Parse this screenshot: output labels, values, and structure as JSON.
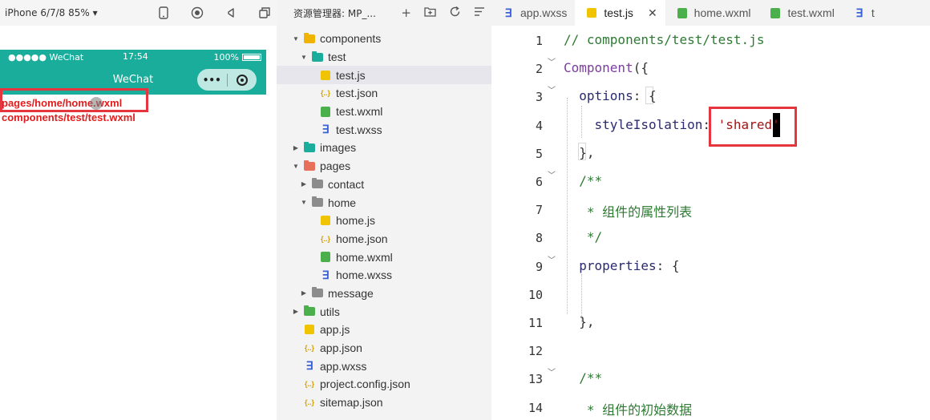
{
  "simulator": {
    "device": "iPhone 6/7/8 85% ▾",
    "status": {
      "signal": "●●●●● WeChat",
      "time": "17:54",
      "battery": "100%"
    },
    "nav_title": "WeChat",
    "capsule_dots": "•••",
    "lines": [
      "pages/home/home.wxml",
      "components/test/test.wxml"
    ],
    "accent": "#1aad9b",
    "highlight": "#e5353f"
  },
  "explorer": {
    "title": "资源管理器: MP_...",
    "tree": [
      {
        "label": "components",
        "type": "folder",
        "color": "#f0b400",
        "depth": 0,
        "open": true
      },
      {
        "label": "test",
        "type": "folder",
        "color": "#1aad9b",
        "depth": 1,
        "open": true
      },
      {
        "label": "test.js",
        "type": "js",
        "depth": 2,
        "selected": true
      },
      {
        "label": "test.json",
        "type": "json",
        "depth": 2
      },
      {
        "label": "test.wxml",
        "type": "wxml",
        "depth": 2
      },
      {
        "label": "test.wxss",
        "type": "wxss",
        "depth": 2
      },
      {
        "label": "images",
        "type": "folder",
        "color": "#1aad9b",
        "depth": 0,
        "open": false
      },
      {
        "label": "pages",
        "type": "folder",
        "color": "#e8705a",
        "depth": 0,
        "open": true
      },
      {
        "label": "contact",
        "type": "folder",
        "color": "#8c8c8c",
        "depth": 1,
        "open": false
      },
      {
        "label": "home",
        "type": "folder",
        "color": "#8c8c8c",
        "depth": 1,
        "open": true
      },
      {
        "label": "home.js",
        "type": "js",
        "depth": 2
      },
      {
        "label": "home.json",
        "type": "json",
        "depth": 2
      },
      {
        "label": "home.wxml",
        "type": "wxml",
        "depth": 2
      },
      {
        "label": "home.wxss",
        "type": "wxss",
        "depth": 2
      },
      {
        "label": "message",
        "type": "folder",
        "color": "#8c8c8c",
        "depth": 1,
        "open": false
      },
      {
        "label": "utils",
        "type": "folder",
        "color": "#4bb04b",
        "depth": 0,
        "open": false
      },
      {
        "label": "app.js",
        "type": "js",
        "depth": 0
      },
      {
        "label": "app.json",
        "type": "json",
        "depth": 0
      },
      {
        "label": "app.wxss",
        "type": "wxss",
        "depth": 0
      },
      {
        "label": "project.config.json",
        "type": "json",
        "depth": 0
      },
      {
        "label": "sitemap.json",
        "type": "json",
        "depth": 0
      }
    ]
  },
  "editor": {
    "tabs": [
      {
        "label": "app.wxss",
        "type": "wxss"
      },
      {
        "label": "test.js",
        "type": "js",
        "active": true
      },
      {
        "label": "home.wxml",
        "type": "wxml"
      },
      {
        "label": "test.wxml",
        "type": "wxml"
      },
      {
        "label": "t",
        "type": "wxss"
      }
    ],
    "close_glyph": "✕",
    "lines": [
      {
        "n": "1",
        "segs": [
          {
            "t": "// components/test/test.js",
            "c": "cmt"
          }
        ]
      },
      {
        "n": "2",
        "fold": true,
        "segs": [
          {
            "t": "Component",
            "c": "kw"
          },
          {
            "t": "({",
            "c": ""
          }
        ]
      },
      {
        "n": "3",
        "fold": true,
        "segs": [
          {
            "t": "  options",
            "c": "prop"
          },
          {
            "t": ": {",
            "c": ""
          }
        ]
      },
      {
        "n": "4",
        "segs": [
          {
            "t": "    styleIsolation",
            "c": "prop"
          },
          {
            "t": ": ",
            "c": ""
          },
          {
            "t": "'shared'",
            "c": "str"
          }
        ]
      },
      {
        "n": "5",
        "segs": [
          {
            "t": "  },",
            "c": ""
          }
        ]
      },
      {
        "n": "6",
        "fold": true,
        "segs": [
          {
            "t": "  /**",
            "c": "cmt"
          }
        ]
      },
      {
        "n": "7",
        "segs": [
          {
            "t": "   * ",
            "c": "cmt"
          },
          {
            "t": "组件的属性列表",
            "c": "cmt zh"
          }
        ]
      },
      {
        "n": "8",
        "segs": [
          {
            "t": "   */",
            "c": "cmt"
          }
        ]
      },
      {
        "n": "9",
        "fold": true,
        "segs": [
          {
            "t": "  properties",
            "c": "prop"
          },
          {
            "t": ": {",
            "c": ""
          }
        ]
      },
      {
        "n": "10",
        "segs": []
      },
      {
        "n": "11",
        "segs": [
          {
            "t": "  },",
            "c": ""
          }
        ]
      },
      {
        "n": "12",
        "segs": []
      },
      {
        "n": "13",
        "fold": true,
        "segs": [
          {
            "t": "  /**",
            "c": "cmt"
          }
        ]
      },
      {
        "n": "14",
        "segs": [
          {
            "t": "   * ",
            "c": "cmt"
          },
          {
            "t": "组件的初始数据",
            "c": "cmt zh"
          }
        ]
      }
    ]
  }
}
